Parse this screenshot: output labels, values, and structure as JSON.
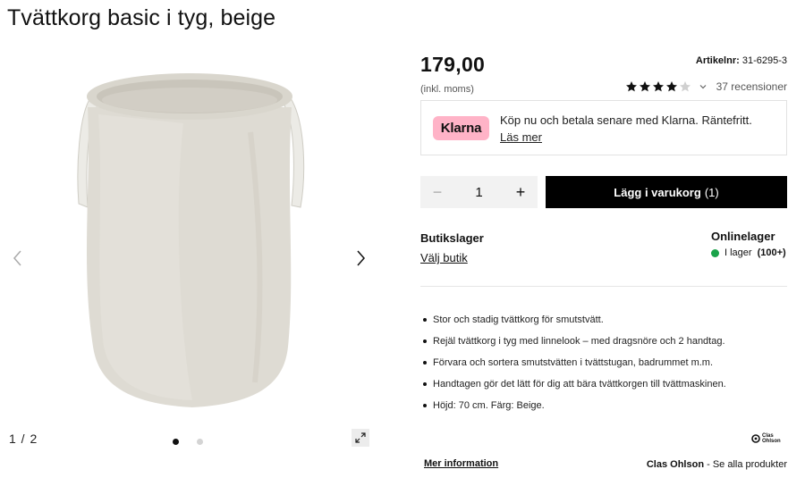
{
  "product": {
    "title": "Tvättkorg basic i tyg, beige",
    "price": "179,00",
    "price_note": "(inkl. moms)",
    "article_label": "Artikelnr:",
    "article_number": "31-6295-3",
    "rating_value": 4,
    "rating_max": 5,
    "reviews_text": "37 recensioner"
  },
  "gallery": {
    "counter": "1 / 2",
    "current": 1,
    "total": 2
  },
  "klarna": {
    "logo_text": "Klarna",
    "text": "Köp nu och betala senare med Klarna. Räntefritt.",
    "link": "Läs mer",
    "color": "#ffb3c7"
  },
  "cart": {
    "quantity": "1",
    "minus": "−",
    "plus": "+",
    "button_label": "Lägg i varukorg",
    "button_count": "(1)"
  },
  "stock": {
    "store_heading": "Butikslager",
    "store_link": "Välj butik",
    "online_heading": "Onlinelager",
    "online_status": "I lager",
    "online_count": "(100+)",
    "status_color": "#1aa34a"
  },
  "features": [
    "Stor och stadig tvättkorg för smutstvätt.",
    "Rejäl tvättkorg i tyg med linnelook – med dragsnöre och 2 handtag.",
    "Förvara och sortera smutstvätten i tvättstugan, badrummet m.m.",
    "Handtagen gör det lätt för dig att bära tvättkorgen till tvättmaskinen.",
    "Höjd: 70 cm. Färg: Beige."
  ],
  "footer": {
    "more_info": "Mer information",
    "brand_name": "Clas Ohlson",
    "brand_link": "- Se alla produkter",
    "logo_line1": "Clas",
    "logo_line2": "Ohlson"
  }
}
